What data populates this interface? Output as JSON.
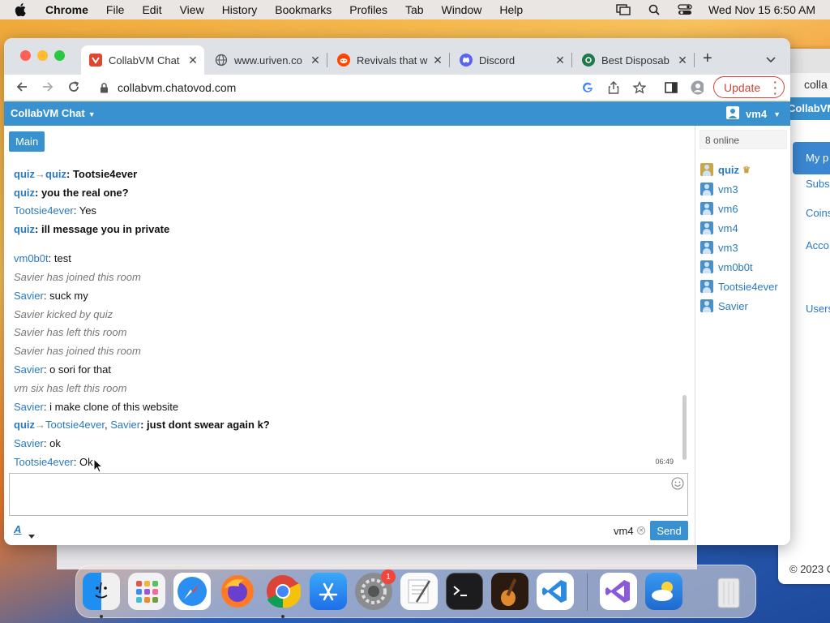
{
  "menubar": {
    "items": [
      "Chrome",
      "File",
      "Edit",
      "View",
      "History",
      "Bookmarks",
      "Profiles",
      "Tab",
      "Window",
      "Help"
    ],
    "clock": "Wed Nov 15  6:50 AM"
  },
  "tabs": [
    {
      "title": "CollabVM Chat",
      "icon": "collabvm-favicon",
      "color": "#e0452f"
    },
    {
      "title": "www.uriven.co",
      "icon": "globe-icon",
      "color": "#666666"
    },
    {
      "title": "Revivals that w",
      "icon": "reddit-icon",
      "color": "#ff4500"
    },
    {
      "title": "Discord",
      "icon": "discord-icon",
      "color": "#5865f2"
    },
    {
      "title": "Best Disposab",
      "icon": "tab-favicon",
      "color": "#1e7a4a"
    }
  ],
  "toolbar": {
    "url": "collabvm.chatovod.com",
    "update_label": "Update"
  },
  "app": {
    "brand": "CollabVM Chat",
    "user": "vm4",
    "room_tab": "Main"
  },
  "messages": [
    {
      "from": "quiz",
      "to": [
        "quiz"
      ],
      "text": "Tootsie4ever",
      "bold": true
    },
    {
      "from": "quiz",
      "text": "you the real one?",
      "bold": true
    },
    {
      "from": "Tootsie4ever",
      "text": "Yes"
    },
    {
      "from": "quiz",
      "text": "ill message you in private",
      "bold": true
    },
    {
      "from": "vm0b0t",
      "text": "test"
    },
    {
      "system": "Savier has joined this room"
    },
    {
      "from": "Savier",
      "text": "suck my"
    },
    {
      "system": "Savier kicked by quiz"
    },
    {
      "system": "Savier has left this room"
    },
    {
      "system": "Savier has joined this room"
    },
    {
      "from": "Savier",
      "text": "o sori for that"
    },
    {
      "system": "vm six has left this room"
    },
    {
      "from": "Savier",
      "text": "i make clone of this website"
    },
    {
      "from": "quiz",
      "to": [
        "Tootsie4ever",
        "Savier"
      ],
      "text": "just dont swear again k?",
      "bold": true
    },
    {
      "from": "Savier",
      "text": "ok"
    },
    {
      "from": "Tootsie4ever",
      "text": "Ok",
      "time": "06:49"
    }
  ],
  "composer": {
    "sender": "vm4",
    "send_label": "Send",
    "format_label": "A"
  },
  "sidebar": {
    "online": "8 online",
    "users": [
      "quiz",
      "vm3",
      "vm6",
      "vm4",
      "vm3",
      "vm0b0t",
      "Tootsie4ever",
      "Savier"
    ]
  },
  "background_window": {
    "address": "colla",
    "bar": "CollabVM",
    "items": [
      "My p",
      "Subs",
      "Coins",
      "Acco",
      "Users"
    ],
    "footer": "© 2023 C"
  },
  "dock": [
    "finder-icon",
    "launchpad-icon",
    "safari-icon",
    "firefox-icon",
    "chrome-icon",
    "app-store-icon",
    "system-settings-icon",
    "textedit-icon",
    "terminal-icon",
    "garageband-icon",
    "vscode-icon",
    "visual-studio-icon",
    "weather-icon",
    "trash-icon"
  ],
  "dock_badge": "1"
}
